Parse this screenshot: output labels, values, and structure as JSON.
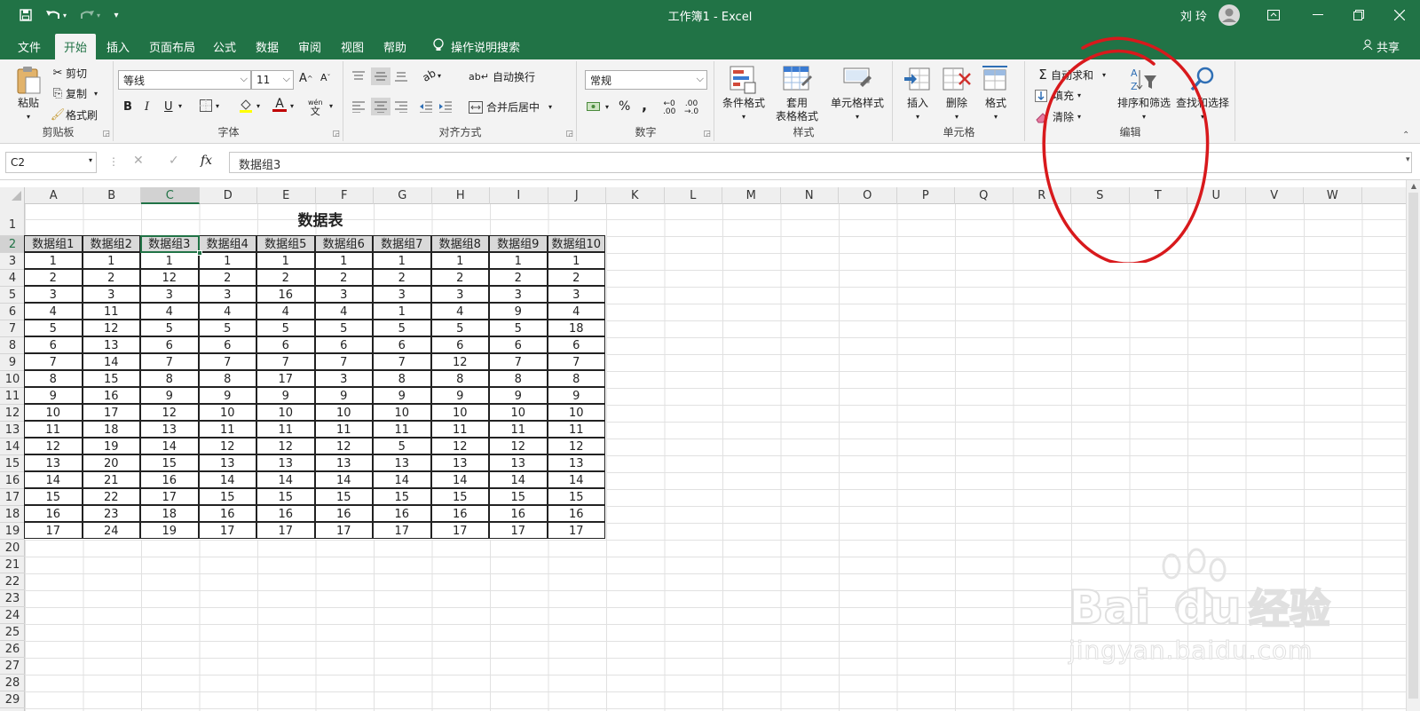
{
  "title": {
    "doc_title": "工作簿1  -  Excel",
    "user_name": "刘 玲",
    "qat": {
      "save_icon": "save-icon",
      "undo_icon": "undo-icon",
      "redo_icon": "redo-icon",
      "customize_icon": "customize-qat-icon"
    }
  },
  "tabs": [
    "文件",
    "开始",
    "插入",
    "页面布局",
    "公式",
    "数据",
    "审阅",
    "视图",
    "帮助"
  ],
  "active_tab": "开始",
  "tell_me": "操作说明搜索",
  "share": "共享",
  "ribbon": {
    "clipboard": {
      "paste": "粘贴",
      "cut": "剪切",
      "copy": "复制",
      "format_painter": "格式刷",
      "label": "剪贴板"
    },
    "font": {
      "name": "等线",
      "size": "11",
      "bold": "B",
      "italic": "I",
      "underline": "U",
      "grow": "A",
      "shrink": "A",
      "font_color_letter": "A",
      "phonetic": "wén",
      "label": "字体",
      "accent": "#c00000"
    },
    "alignment": {
      "wrap": "自动换行",
      "merge": "合并后居中",
      "label": "对齐方式"
    },
    "number": {
      "format": "常规",
      "percent": "%",
      "comma": ",",
      "inc": ".00",
      "dec": ".00",
      "label": "数字"
    },
    "styles": {
      "conditional": "条件格式",
      "table_line1": "套用",
      "table_line2": "表格格式",
      "cell_styles": "单元格样式",
      "label": "样式"
    },
    "cells": {
      "insert": "插入",
      "delete": "删除",
      "format": "格式",
      "label": "单元格"
    },
    "editing": {
      "autosum": "自动求和",
      "fill": "填充",
      "clear": "清除",
      "sort_filter": "排序和筛选",
      "find_select": "查找和选择",
      "label": "编辑"
    }
  },
  "formula_bar": {
    "name_box": "C2",
    "fx": "fx",
    "content": "数据组3"
  },
  "sheet": {
    "columns": [
      "A",
      "B",
      "C",
      "D",
      "E",
      "F",
      "G",
      "H",
      "I",
      "J",
      "K",
      "L",
      "M",
      "N",
      "O",
      "P",
      "Q",
      "R",
      "S",
      "T",
      "U",
      "V",
      "W"
    ],
    "selected_column": "C",
    "selected_row": 2,
    "rows": [
      1,
      2,
      3,
      4,
      5,
      6,
      7,
      8,
      9,
      10,
      11,
      12,
      13,
      14,
      15,
      16,
      17,
      18,
      19,
      20,
      21,
      22,
      23,
      24,
      25,
      26,
      27,
      28,
      29
    ],
    "table_title": "数据表",
    "headers": [
      "数据组1",
      "数据组2",
      "数据组3",
      "数据组4",
      "数据组5",
      "数据组6",
      "数据组7",
      "数据组8",
      "数据组9",
      "数据组10"
    ],
    "data": [
      [
        1,
        1,
        1,
        1,
        1,
        1,
        1,
        1,
        1,
        1
      ],
      [
        2,
        2,
        12,
        2,
        2,
        2,
        2,
        2,
        2,
        2
      ],
      [
        3,
        3,
        3,
        3,
        16,
        3,
        3,
        3,
        3,
        3
      ],
      [
        4,
        11,
        4,
        4,
        4,
        4,
        1,
        4,
        9,
        4
      ],
      [
        5,
        12,
        5,
        5,
        5,
        5,
        5,
        5,
        5,
        18
      ],
      [
        6,
        13,
        6,
        6,
        6,
        6,
        6,
        6,
        6,
        6
      ],
      [
        7,
        14,
        7,
        7,
        7,
        7,
        7,
        12,
        7,
        7
      ],
      [
        8,
        15,
        8,
        8,
        17,
        3,
        8,
        8,
        8,
        8
      ],
      [
        9,
        16,
        9,
        9,
        9,
        9,
        9,
        9,
        9,
        9
      ],
      [
        10,
        17,
        12,
        10,
        10,
        10,
        10,
        10,
        10,
        10
      ],
      [
        11,
        18,
        13,
        11,
        11,
        11,
        11,
        11,
        11,
        11
      ],
      [
        12,
        19,
        14,
        12,
        12,
        12,
        5,
        12,
        12,
        12
      ],
      [
        13,
        20,
        15,
        13,
        13,
        13,
        13,
        13,
        13,
        13
      ],
      [
        14,
        21,
        16,
        14,
        14,
        14,
        14,
        14,
        14,
        14
      ],
      [
        15,
        22,
        17,
        15,
        15,
        15,
        15,
        15,
        15,
        15
      ],
      [
        16,
        23,
        18,
        16,
        16,
        16,
        16,
        16,
        16,
        16
      ],
      [
        17,
        24,
        19,
        17,
        17,
        17,
        17,
        17,
        17,
        17
      ]
    ]
  },
  "annotation_color": "#d8191c",
  "watermark": {
    "brand": "Bai",
    "du": "du",
    "jingyan": "经验",
    "url": "jingyan.baidu.com"
  }
}
